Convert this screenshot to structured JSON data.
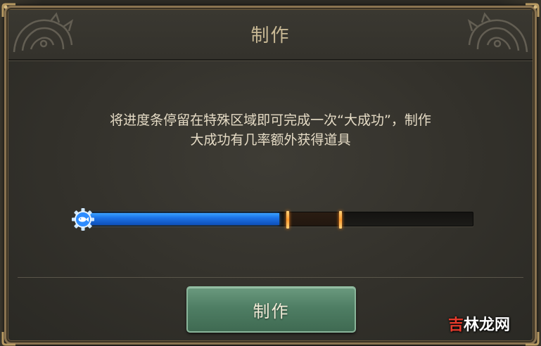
{
  "dialog": {
    "title": "制作",
    "description_line1": "将进度条停留在特殊区域即可完成一次“大成功”，制作",
    "description_line2": "大成功有几率额外获得道具"
  },
  "progress": {
    "fill_fraction": 0.503,
    "zone_start_fraction": 0.525,
    "zone_end_fraction": 0.66,
    "fill_color": "#1c73e8",
    "zone_marker_color": "#ff9a2e",
    "knob_icon": "fish-icon"
  },
  "button": {
    "label": "制作",
    "color": "#4f7e64"
  },
  "watermark": {
    "char1": "吉",
    "char2": "林",
    "char3": "龙",
    "char4": "网"
  },
  "icons": {
    "ornament_left": "dragon-ornament-icon",
    "ornament_right": "dragon-ornament-icon"
  }
}
